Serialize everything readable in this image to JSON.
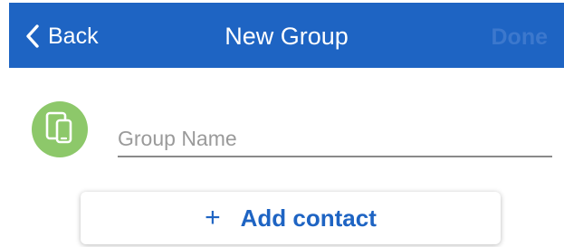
{
  "navbar": {
    "back_label": "Back",
    "title": "New Group",
    "done_label": "Done",
    "back_icon": "chevron-left-icon",
    "color": "#1e64c3"
  },
  "group": {
    "avatar_icon": "devices-icon",
    "avatar_color": "#8dc86a",
    "name_value": "",
    "name_placeholder": "Group Name"
  },
  "actions": {
    "add_icon": "plus-icon",
    "add_contact_label": "Add contact"
  }
}
